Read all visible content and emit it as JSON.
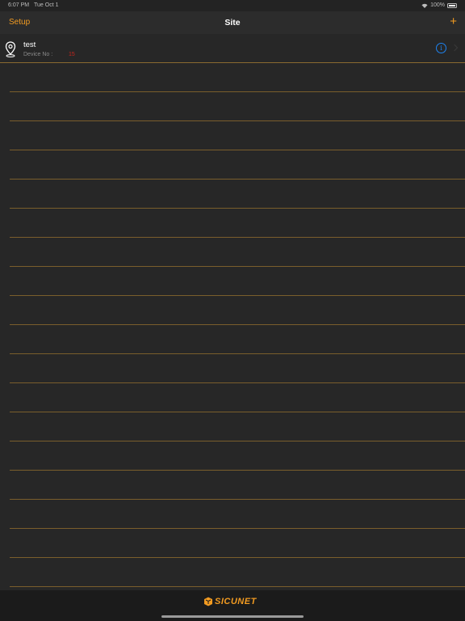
{
  "status_bar": {
    "time": "6:07 PM",
    "date": "Tue Oct 1",
    "battery": "100%"
  },
  "nav": {
    "back_label": "Setup",
    "title": "Site",
    "add_label": "+"
  },
  "sites": [
    {
      "name": "test",
      "device_label": "Device No :",
      "device_count": "15"
    }
  ],
  "empty_rows": 18,
  "footer": {
    "logo_text": "SICUNET"
  },
  "colors": {
    "accent": "#f29b21",
    "info": "#1e83f0",
    "count": "#c4261d",
    "separator": "#7a5e2c"
  }
}
